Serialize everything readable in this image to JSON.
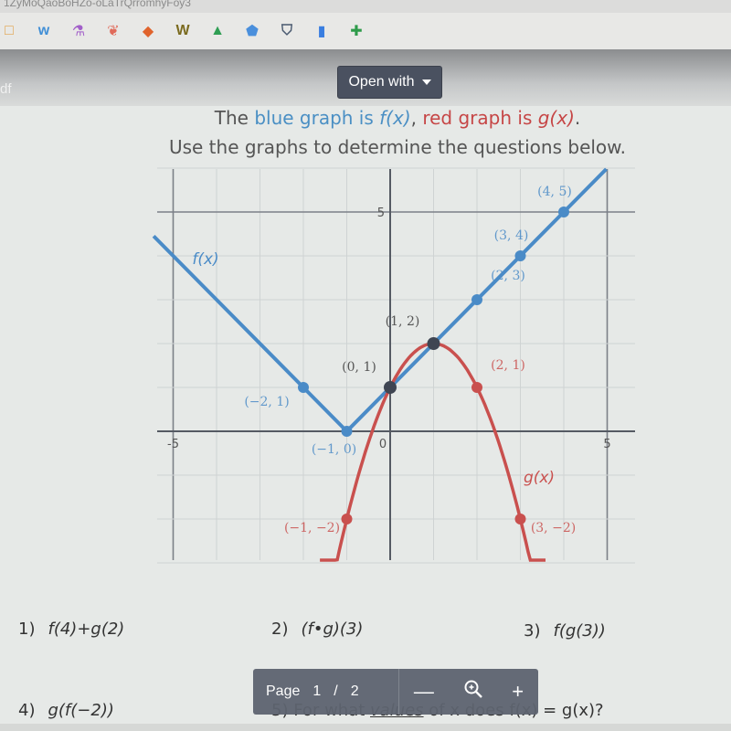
{
  "browser": {
    "tab_text": "1ZyMoQaoBoHZo-oLaTrQrromhyFoy3",
    "bookmarks": [
      {
        "icon": "square-outline-icon",
        "glyph": "□",
        "color": "#e1a24a"
      },
      {
        "icon": "weebly-icon",
        "glyph": "w",
        "color": "#3f8ed6"
      },
      {
        "icon": "flask-icon",
        "glyph": "⚗",
        "color": "#a25fc9"
      },
      {
        "icon": "hat-icon",
        "glyph": "❦",
        "color": "#e06a5a"
      },
      {
        "icon": "diamond-icon",
        "glyph": "◆",
        "color": "#e0632c"
      },
      {
        "icon": "w-logo-icon",
        "glyph": "W",
        "color": "#7a6a1e"
      },
      {
        "icon": "drive-icon",
        "glyph": "▲",
        "color": "#2f9e53"
      },
      {
        "icon": "graduation-cap-icon",
        "glyph": "⬟",
        "color": "#4a8fdc"
      },
      {
        "icon": "acorn-icon",
        "glyph": "⛉",
        "color": "#4a5a70"
      },
      {
        "icon": "bookmark-icon",
        "glyph": "▮",
        "color": "#3a7ee0"
      },
      {
        "icon": "classroom-icon",
        "glyph": "✚",
        "color": "#2e9b4a"
      }
    ]
  },
  "viewer": {
    "filename_fragment": "df",
    "open_with_label": "Open with",
    "page_label": "Page",
    "current_page": "1",
    "page_sep": "/",
    "total_pages": "2",
    "zoom_out": "—",
    "zoom_in": "+"
  },
  "document": {
    "title_line1": {
      "t1": "The ",
      "t2": "blue graph is ",
      "t3": "f(x)",
      "t4": ", ",
      "t5": "red graph is ",
      "t6": "g(x)",
      "t7": "."
    },
    "title_line2": "Use the graphs to determine the questions below.",
    "questions": [
      {
        "num": "1)",
        "expr": "f(4)+g(2)"
      },
      {
        "num": "2)",
        "expr": "(f•g)(3)"
      },
      {
        "num": "3)",
        "expr": "f(g(3))"
      },
      {
        "num": "4)",
        "expr": "g(f(−2))"
      }
    ],
    "question5": {
      "num": "5)",
      "pre": "For what ",
      "underlined": "values",
      "post": " of x does f(x) = g(x)?"
    }
  },
  "chart_data": {
    "type": "line",
    "title": "",
    "xlabel": "",
    "ylabel": "",
    "xlim": [
      -5.5,
      5.6
    ],
    "ylim": [
      -3,
      6
    ],
    "x_ticks": [
      -5,
      0,
      5
    ],
    "x_tick_labels": [
      "-5",
      "0",
      "5"
    ],
    "y_ticks": [
      5
    ],
    "y_tick_labels": [
      "5"
    ],
    "grid": true,
    "series": [
      {
        "name": "f(x)",
        "color": "#4a8bc7",
        "label_text": "f(x)",
        "formula": "|x+1|",
        "points": [
          {
            "x": -2,
            "y": 1,
            "label": "(−2, 1)"
          },
          {
            "x": -1,
            "y": 0,
            "label": "(−1, 0)"
          },
          {
            "x": 2,
            "y": 3,
            "label": "(2, 3)"
          },
          {
            "x": 3,
            "y": 4,
            "label": "(3, 4)"
          },
          {
            "x": 4,
            "y": 5,
            "label": "(4, 5)"
          }
        ]
      },
      {
        "name": "g(x)",
        "color": "#c9504e",
        "label_text": "g(x)",
        "formula": "-(x-1)^2+2",
        "points": [
          {
            "x": -1,
            "y": -2,
            "label": "(−1, −2)"
          },
          {
            "x": 2,
            "y": 1,
            "label": "(2, 1)"
          },
          {
            "x": 3,
            "y": -2,
            "label": "(3, −2)"
          }
        ]
      }
    ],
    "intersections": [
      {
        "x": 0,
        "y": 1,
        "label": "(0, 1)"
      },
      {
        "x": 1,
        "y": 2,
        "label": "(1, 2)"
      }
    ]
  }
}
